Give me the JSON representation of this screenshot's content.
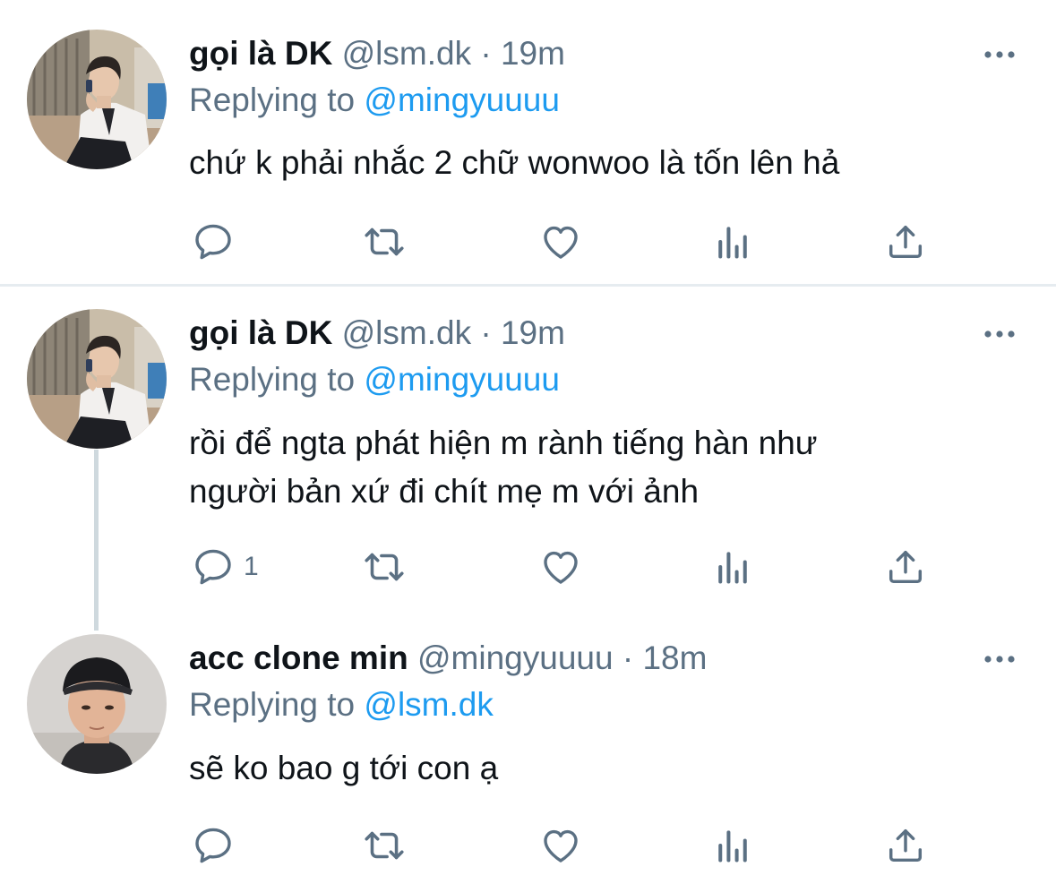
{
  "colors": {
    "text": "#0f1419",
    "muted": "#5b7083",
    "link": "#1d9bf0",
    "divider": "#e6ecf0",
    "thread_line": "#cfd9de"
  },
  "tweets": [
    {
      "name": "gọi là DK",
      "handle": "@lsm.dk",
      "separator": "·",
      "time": "19m",
      "replying_prefix": "Replying to",
      "replying_to": "@mingyuuuu",
      "lines": [
        "chứ k phải nhắc 2 chữ wonwoo là tốn lên hả"
      ],
      "reply_count": "",
      "icons": [
        "reply-icon",
        "retweet-icon",
        "like-icon",
        "analytics-icon",
        "share-icon",
        "more-icon"
      ]
    },
    {
      "name": "gọi là DK",
      "handle": "@lsm.dk",
      "separator": "·",
      "time": "19m",
      "replying_prefix": "Replying to",
      "replying_to": "@mingyuuuu",
      "lines": [
        "rồi để ngta phát hiện m rành tiếng hàn như",
        "người bản xứ đi chít mẹ m với ảnh"
      ],
      "reply_count": "1",
      "icons": [
        "reply-icon",
        "retweet-icon",
        "like-icon",
        "analytics-icon",
        "share-icon",
        "more-icon"
      ]
    },
    {
      "name": "acc clone min",
      "handle": "@mingyuuuu",
      "separator": "·",
      "time": "18m",
      "replying_prefix": "Replying to",
      "replying_to": "@lsm.dk",
      "lines": [
        "sẽ ko bao g tới con ạ"
      ],
      "reply_count": "",
      "icons": [
        "reply-icon",
        "retweet-icon",
        "like-icon",
        "analytics-icon",
        "share-icon",
        "more-icon"
      ]
    }
  ]
}
